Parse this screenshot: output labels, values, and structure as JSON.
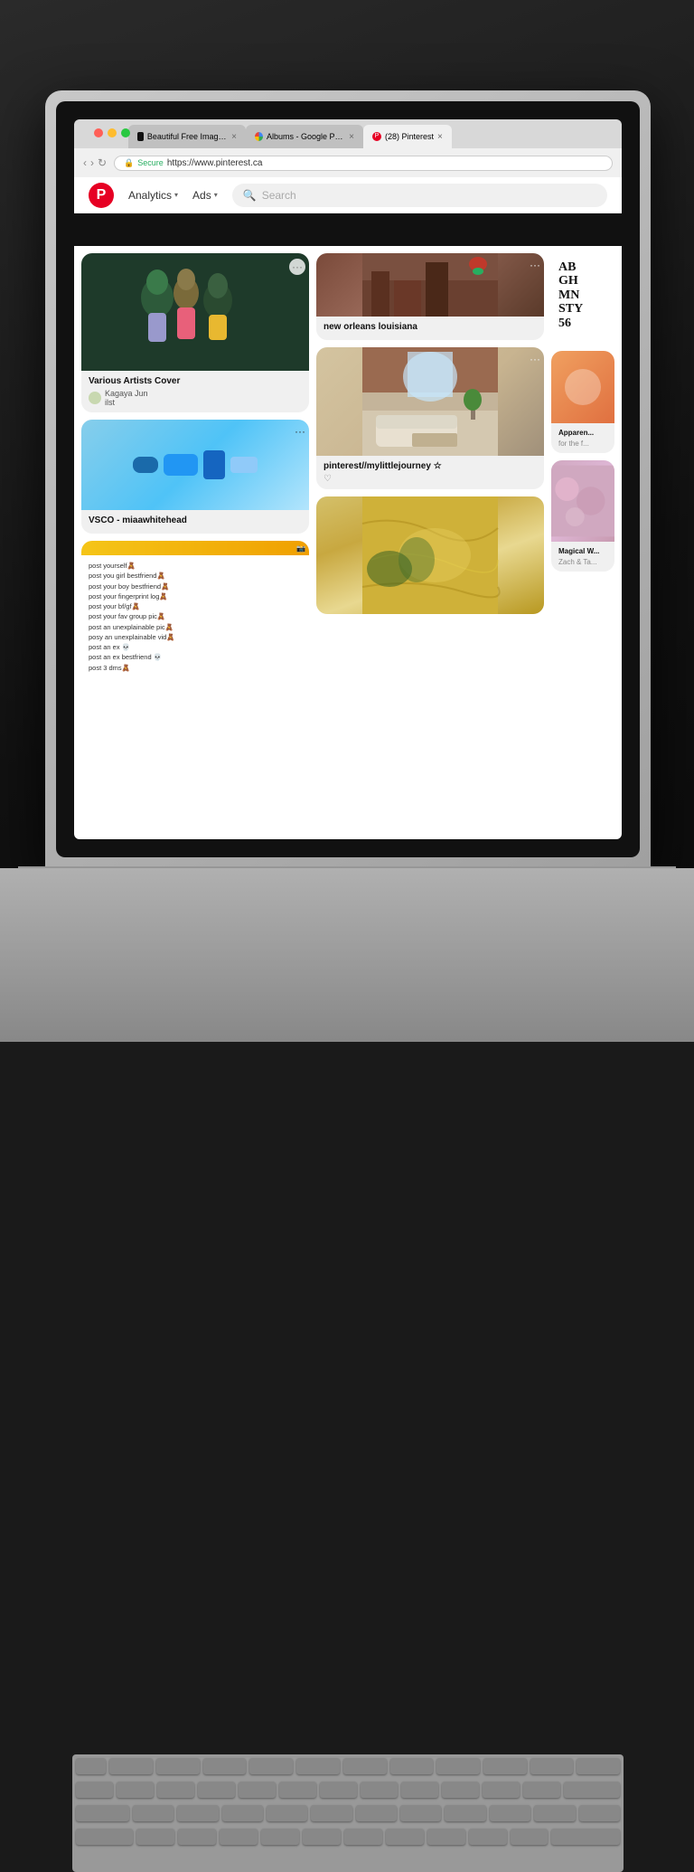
{
  "scene": {
    "background": "#1a1a1a"
  },
  "browser": {
    "tabs": [
      {
        "id": "tab-unsplash",
        "label": "Beautiful Free Images & Pictur...",
        "favicon": "unsplash",
        "active": false
      },
      {
        "id": "tab-google-photos",
        "label": "Albums - Google Photos",
        "favicon": "google",
        "active": false
      },
      {
        "id": "tab-pinterest",
        "label": "(28) Pinterest",
        "favicon": "pinterest",
        "active": true
      }
    ],
    "address": {
      "secure": true,
      "secure_label": "Secure",
      "url": "https://www.pinterest.ca"
    }
  },
  "pinterest": {
    "nav": {
      "analytics_label": "Analytics",
      "ads_label": "Ads",
      "search_placeholder": "Search"
    },
    "pins": {
      "col1": [
        {
          "type": "vases",
          "title": "Various Artists Cover",
          "author": "Kagaya Jun",
          "author_sub": "ilst"
        },
        {
          "type": "vsco",
          "title": "VSCO - miaawhitehead"
        },
        {
          "type": "text_post",
          "lines": [
            "post yourself🧸",
            "post you girl bestfriend🧸",
            "post your boy bestfriend🧸",
            "post your fingerprint log🧸",
            "post your bf/gf🧸",
            "post your fav group pic🧸",
            "post an unexplainable pic🧸",
            "posy an unexplainable vid🧸",
            "post an ex 💀",
            "post an ex bestfriend 💀",
            "post 3 dms🧸"
          ]
        }
      ],
      "col2": [
        {
          "type": "new_orleans",
          "title": "new orleans louisiana"
        },
        {
          "type": "living_room",
          "title": "pinterest//mylittlejourney ☆",
          "has_heart": true
        },
        {
          "type": "yellow_marble"
        }
      ],
      "col3": [
        {
          "type": "typography",
          "lines": [
            "AB",
            "GH",
            "MN",
            "STY",
            "56"
          ]
        },
        {
          "type": "apparently",
          "title": "Apparen...",
          "subtitle": "for the f..."
        },
        {
          "type": "magical",
          "title": "Magical W...",
          "subtitle": "Zach & Ta..."
        },
        {
          "type": "flowers"
        },
        {
          "type": "dark_door"
        }
      ]
    }
  }
}
